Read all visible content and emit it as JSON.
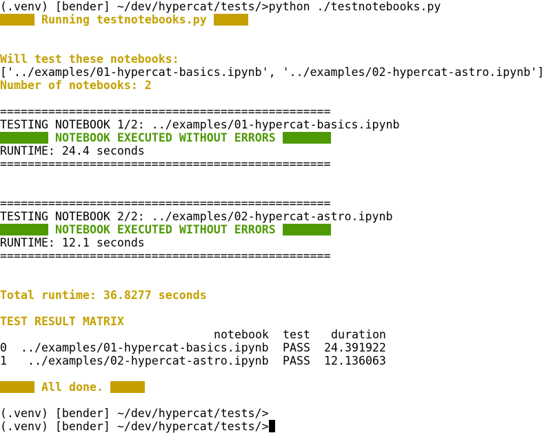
{
  "prompt_start": "(.venv) [bender] ~/dev/hypercat/tests/>",
  "command": "python ./testnotebooks.py",
  "running_label": "Running testnotebooks.py",
  "will_test_label": "Will test these notebooks:",
  "notebook_list": "['../examples/01-hypercat-basics.ipynb', '../examples/02-hypercat-astro.ipynb']",
  "number_label": "Number of notebooks: 2",
  "separator": "================================================",
  "tests": [
    {
      "header": "TESTING NOTEBOOK 1/2: ../examples/01-hypercat-basics.ipynb",
      "status": "NOTEBOOK EXECUTED WITHOUT ERRORS",
      "runtime": "RUNTIME: 24.4 seconds"
    },
    {
      "header": "TESTING NOTEBOOK 2/2: ../examples/02-hypercat-astro.ipynb",
      "status": "NOTEBOOK EXECUTED WITHOUT ERRORS",
      "runtime": "RUNTIME: 12.1 seconds"
    }
  ],
  "total_runtime": "Total runtime: 36.8277 seconds",
  "matrix_title": "TEST RESULT MATRIX",
  "matrix": {
    "columns": [
      "notebook",
      "test",
      "duration"
    ],
    "rows": [
      {
        "index": "0",
        "notebook": "../examples/01-hypercat-basics.ipynb",
        "test": "PASS",
        "duration": "24.391922"
      },
      {
        "index": "1",
        "notebook": "../examples/02-hypercat-astro.ipynb",
        "test": "PASS",
        "duration": "12.136063"
      }
    ]
  },
  "done_label": "All done.",
  "final_prompts": [
    "(.venv) [bender] ~/dev/hypercat/tests/>",
    "(.venv) [bender] ~/dev/hypercat/tests/>"
  ],
  "colors": {
    "yellow": "#c4a000",
    "green": "#4e9a06",
    "text": "#000000",
    "background": "#ffffff"
  }
}
